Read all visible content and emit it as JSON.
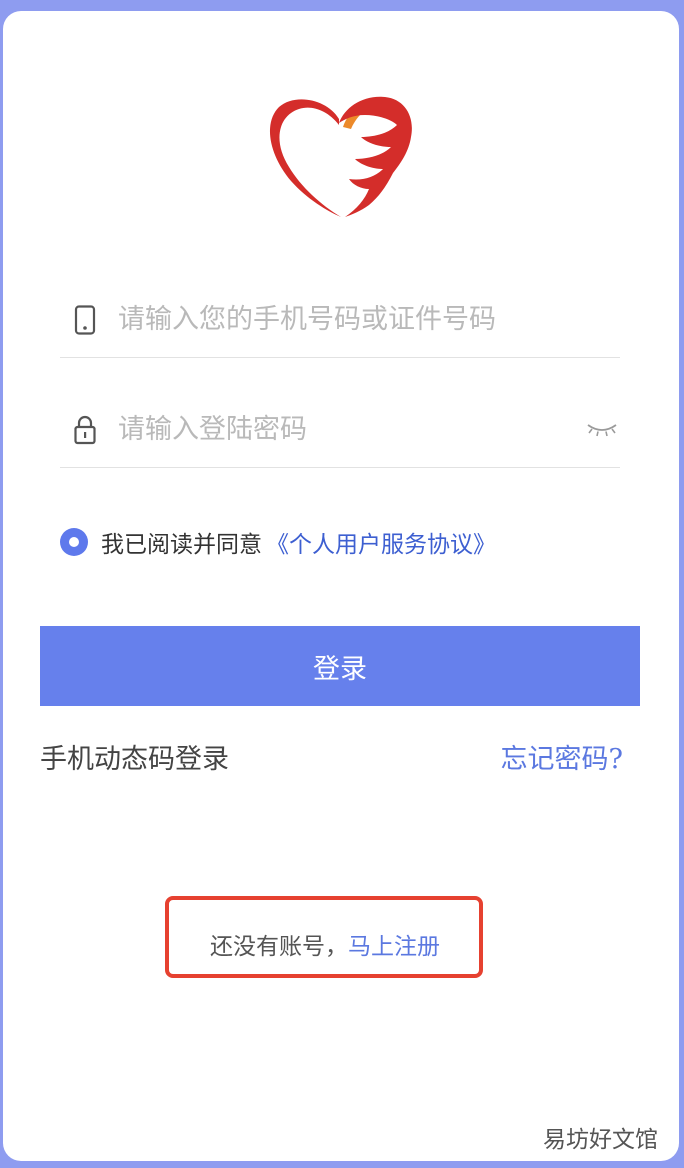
{
  "logo": {
    "icon": "heart-logo-icon",
    "colors": {
      "red": "#d42d2a",
      "orange": "#ec8a2a"
    }
  },
  "login_form": {
    "account_field": {
      "icon": "phone-icon",
      "placeholder": "请输入您的手机号码或证件号码",
      "value": ""
    },
    "password_field": {
      "icon": "lock-icon",
      "placeholder": "请输入登陆密码",
      "value": "",
      "toggle_icon": "eye-closed-icon"
    },
    "agreement": {
      "checked": true,
      "text": "我已阅读并同意",
      "link": "《个人用户服务协议》"
    },
    "login_button": "登录",
    "sms_login": "手机动态码登录",
    "forgot_password": "忘记密码?",
    "register": {
      "prompt": "还没有账号，",
      "link": "马上注册"
    }
  },
  "watermark": "易坊好文馆",
  "colors": {
    "accent": "#6680ec",
    "link": "#5b78e0",
    "highlight": "#e64130",
    "background": "#8e9cf0"
  }
}
